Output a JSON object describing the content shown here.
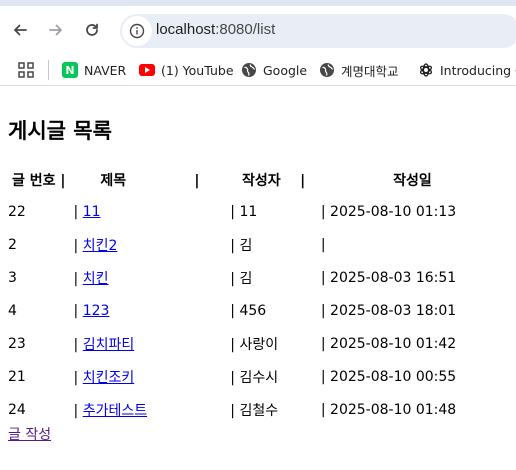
{
  "browser": {
    "url_host": "localhost",
    "url_path": ":8080/list",
    "bookmarks": [
      {
        "label": "NAVER",
        "icon": "naver-icon"
      },
      {
        "label": "(1) YouTube",
        "icon": "youtube-icon"
      },
      {
        "label": "Google",
        "icon": "globe-icon"
      },
      {
        "label": "계명대학교",
        "icon": "globe-icon"
      },
      {
        "label": "Introducing Ch",
        "icon": "openai-icon"
      }
    ],
    "naver_letter": "N"
  },
  "page": {
    "title": "게시글 목록",
    "columns": [
      "글 번호",
      "|",
      "제목",
      "|",
      "작성자",
      "|",
      "작성일"
    ],
    "rows": [
      {
        "id": "22",
        "title_prefix": "| ",
        "title": "11",
        "author": "| 11",
        "date": "| 2025-08-10 01:13"
      },
      {
        "id": "2",
        "title_prefix": "| ",
        "title": "치킨2",
        "author": "| 김",
        "date": "|"
      },
      {
        "id": "3",
        "title_prefix": "| ",
        "title": "치킨",
        "author": "| 김",
        "date": "| 2025-08-03 16:51"
      },
      {
        "id": "4",
        "title_prefix": "| ",
        "title": "123",
        "author": "| 456",
        "date": "| 2025-08-03 18:01"
      },
      {
        "id": "23",
        "title_prefix": "| ",
        "title": "김치파티",
        "author": "| 사랑이",
        "date": "| 2025-08-10 01:42"
      },
      {
        "id": "21",
        "title_prefix": "| ",
        "title": "치킨조키",
        "author": "| 김수시",
        "date": "| 2025-08-10 00:55"
      },
      {
        "id": "24",
        "title_prefix": "| ",
        "title": "추가테스트",
        "author": "| 김철수",
        "date": "| 2025-08-10 01:48"
      }
    ],
    "write_link": "글 작성"
  },
  "colors": {
    "link": "#0000ee",
    "visited_link": "#551a8b",
    "omnibox_bg": "#e9eef6",
    "naver_green": "#03c75a",
    "youtube_red": "#ff0000"
  }
}
